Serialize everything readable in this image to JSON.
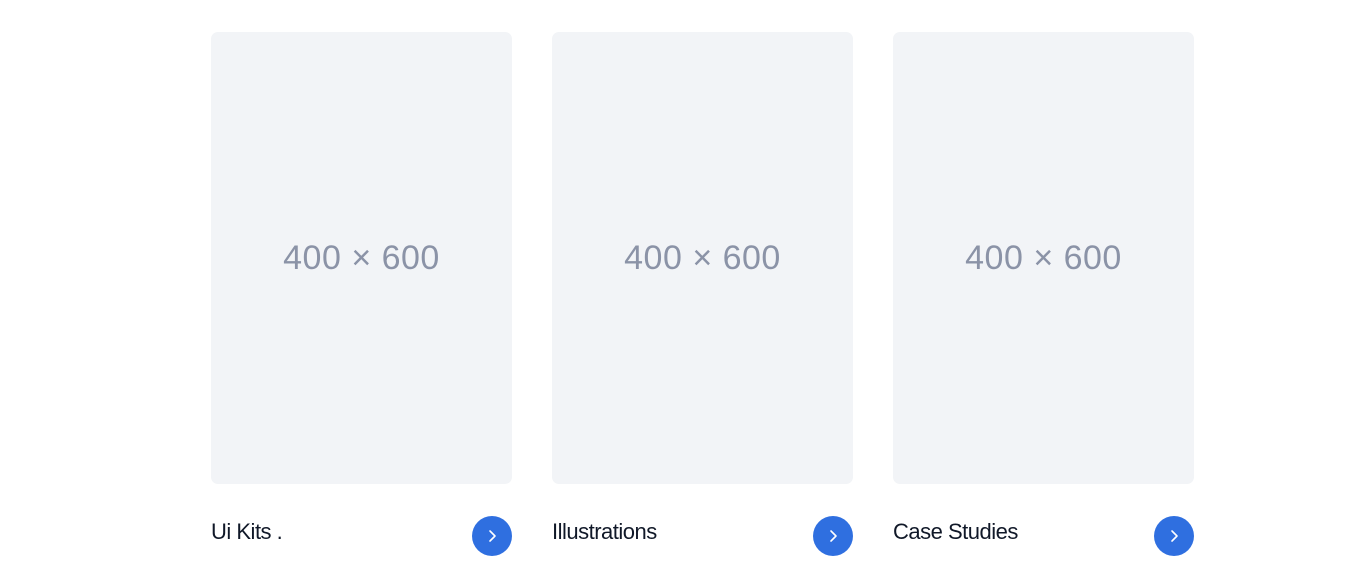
{
  "cards": [
    {
      "placeholder": "400 × 600",
      "title": "Ui Kits ."
    },
    {
      "placeholder": "400 × 600",
      "title": "Illustrations"
    },
    {
      "placeholder": "400 × 600",
      "title": "Case Studies"
    }
  ],
  "colors": {
    "placeholder_bg": "#f2f4f7",
    "placeholder_text": "#8b93a7",
    "title_text": "#101828",
    "accent": "#2f6fe0"
  },
  "icons": {
    "card_button": "chevron-right-icon"
  }
}
